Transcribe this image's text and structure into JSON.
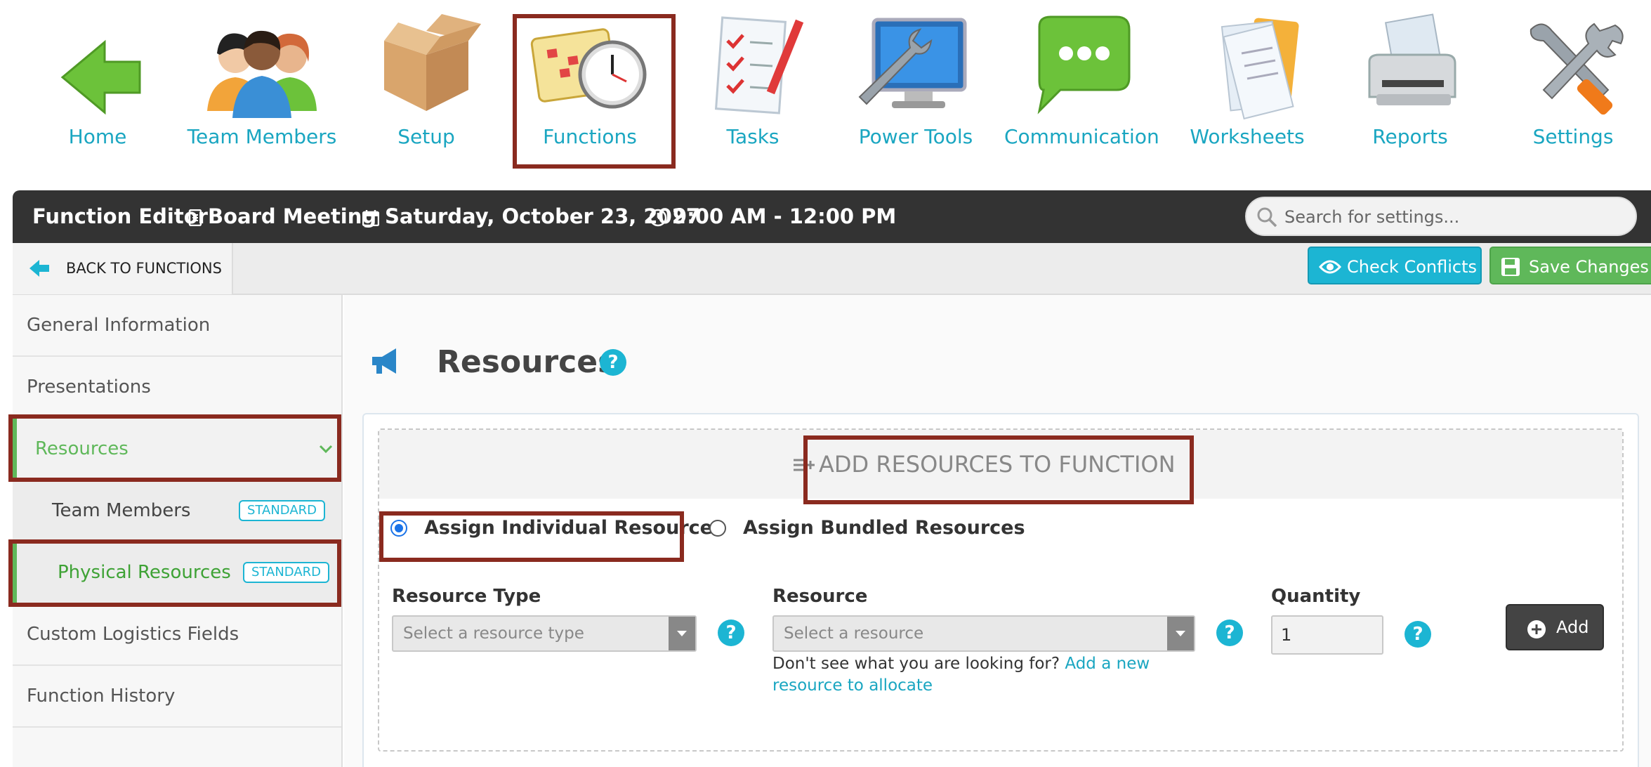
{
  "nav": {
    "items": [
      {
        "label": "Home"
      },
      {
        "label": "Team Members"
      },
      {
        "label": "Setup"
      },
      {
        "label": "Functions"
      },
      {
        "label": "Tasks"
      },
      {
        "label": "Power Tools"
      },
      {
        "label": "Communication"
      },
      {
        "label": "Worksheets"
      },
      {
        "label": "Reports"
      },
      {
        "label": "Settings"
      }
    ],
    "selected": "Functions"
  },
  "titlebar": {
    "editor": "Function Editor",
    "function_name": "Board Meeting",
    "date": "Saturday, October 23, 2027",
    "time": "9:00 AM - 12:00 PM",
    "search_placeholder": "Search for settings..."
  },
  "actionbar": {
    "back_label": "BACK TO FUNCTIONS",
    "check_conflicts_label": "Check Conflicts",
    "save_label": "Save Changes"
  },
  "sidebar": {
    "items": [
      {
        "label": "General Information"
      },
      {
        "label": "Presentations"
      },
      {
        "label": "Resources"
      },
      {
        "label": "Team Members",
        "badge": "STANDARD"
      },
      {
        "label": "Physical Resources",
        "badge": "STANDARD"
      },
      {
        "label": "Custom Logistics Fields"
      },
      {
        "label": "Function History"
      }
    ],
    "active": "Resources",
    "active_sub": "Physical Resources"
  },
  "main": {
    "title": "Resources",
    "help_glyph": "?",
    "add_header": "ADD RESOURCES TO FUNCTION",
    "radio_individual": "Assign Individual Resources",
    "radio_bundled": "Assign Bundled Resources",
    "resource_type_label": "Resource Type",
    "resource_type_placeholder": "Select a resource type",
    "resource_label": "Resource",
    "resource_placeholder": "Select a resource",
    "quantity_label": "Quantity",
    "quantity_value": "1",
    "hint_text": "Don't see what you are looking for? ",
    "hint_link": "Add a new resource to allocate",
    "add_button": "Add"
  },
  "colors": {
    "accent": "#1cb5d3",
    "success": "#5fb85a",
    "titlebar": "#333333",
    "highlight": "#8a2a1f",
    "nav_text": "#1aa6c1"
  }
}
